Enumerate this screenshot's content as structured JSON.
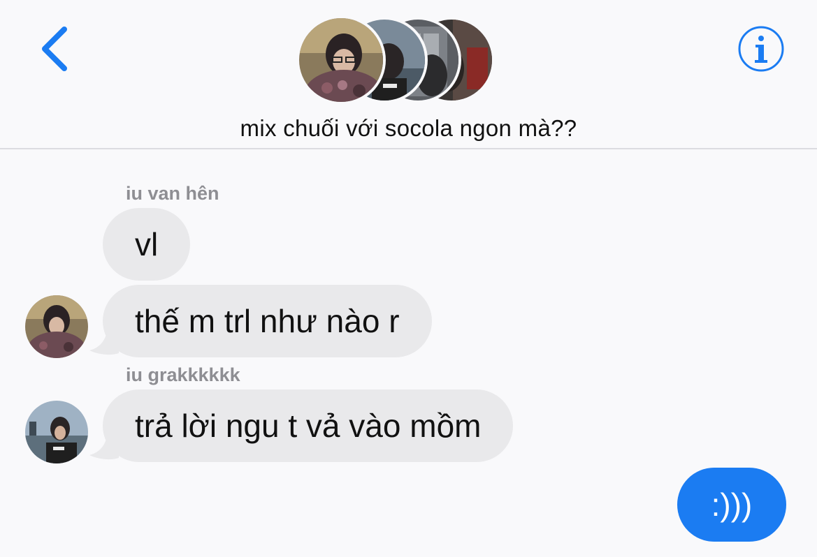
{
  "header": {
    "back_icon": "chevron-left-icon",
    "info_icon": "info-circle-icon",
    "group_title": "mix chuối với socola ngon mà??",
    "accent_color": "#1b7cf2"
  },
  "messages": [
    {
      "sender": "iu van hên",
      "text": "vl",
      "direction": "incoming"
    },
    {
      "sender": "",
      "text": "thế m trl như nào r",
      "direction": "incoming"
    },
    {
      "sender": "iu grakkkkkk",
      "text": "trả lời ngu t vả vào mồm",
      "direction": "incoming"
    },
    {
      "sender": "",
      "text": ":)))",
      "direction": "outgoing"
    }
  ],
  "colors": {
    "incoming_bubble": "#e9e9eb",
    "outgoing_bubble": "#1b7cf2",
    "sender_name": "#8e8e93",
    "background": "#f9f9fb"
  }
}
